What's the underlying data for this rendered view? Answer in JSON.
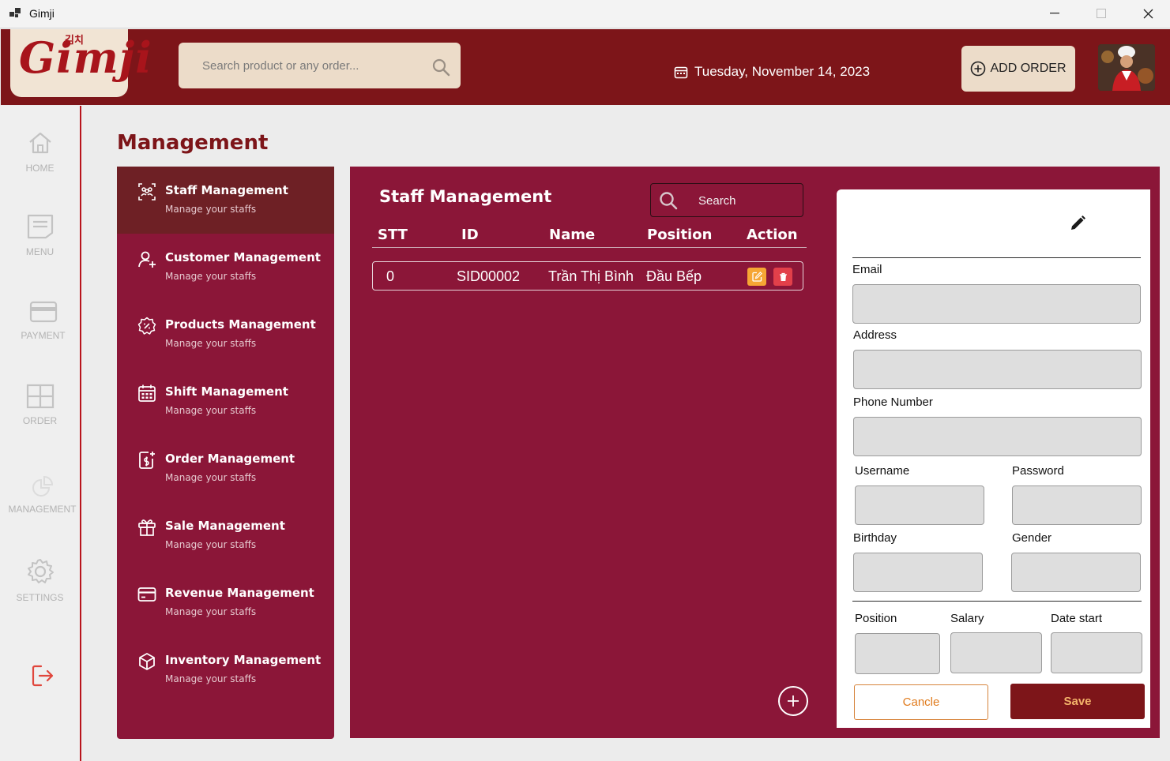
{
  "window": {
    "title": "Gimji"
  },
  "header": {
    "logo_text": "Gimji",
    "logo_korean": "김치",
    "search_placeholder": "Search product or any order...",
    "date": "Tuesday, November 14, 2023",
    "add_order_label": "ADD ORDER"
  },
  "leftnav": {
    "items": [
      {
        "label": "HOME",
        "icon": "home-icon"
      },
      {
        "label": "MENU",
        "icon": "menu-icon"
      },
      {
        "label": "PAYMENT",
        "icon": "payment-icon"
      },
      {
        "label": "ORDER",
        "icon": "order-icon"
      },
      {
        "label": "MANAGEMENT",
        "icon": "management-icon"
      },
      {
        "label": "SETTINGS",
        "icon": "settings-icon"
      }
    ],
    "logout_icon": "logout-icon"
  },
  "page": {
    "title": "Management"
  },
  "management_menu": {
    "items": [
      {
        "title": "Staff Management",
        "subtitle": "Manage your staffs",
        "icon": "staff-icon",
        "active": true
      },
      {
        "title": "Customer Management",
        "subtitle": "Manage your staffs",
        "icon": "customer-icon"
      },
      {
        "title": "Products Management",
        "subtitle": "Manage your staffs",
        "icon": "products-icon"
      },
      {
        "title": "Shift Management",
        "subtitle": "Manage your staffs",
        "icon": "shift-icon"
      },
      {
        "title": "Order Management",
        "subtitle": "Manage your staffs",
        "icon": "order-doc-icon"
      },
      {
        "title": "Sale Management",
        "subtitle": "Manage your staffs",
        "icon": "gift-icon"
      },
      {
        "title": "Revenue Management",
        "subtitle": "Manage your staffs",
        "icon": "card-icon"
      },
      {
        "title": "Inventory Management",
        "subtitle": "Manage your staffs",
        "icon": "box-icon"
      }
    ]
  },
  "staff_panel": {
    "title": "Staff Management",
    "search_placeholder": "Search",
    "columns": [
      "STT",
      "ID",
      "Name",
      "Position",
      "Action"
    ],
    "rows": [
      {
        "stt": "0",
        "id": "SID00002",
        "name": "Trần Thị Bình",
        "position": "Đầu Bếp"
      }
    ]
  },
  "form": {
    "labels": {
      "email": "Email",
      "address": "Address",
      "phone": "Phone Number",
      "username": "Username",
      "password": "Password",
      "birthday": "Birthday",
      "gender": "Gender",
      "position": "Position",
      "salary": "Salary",
      "date_start": "Date start"
    },
    "cancel_label": "Cancle",
    "save_label": "Save"
  },
  "colors": {
    "brand": "#7d1519",
    "panel": "#8b1638",
    "edit_button": "#f6a634",
    "delete_button": "#e2404a",
    "cancel_text": "#e07b1d"
  }
}
